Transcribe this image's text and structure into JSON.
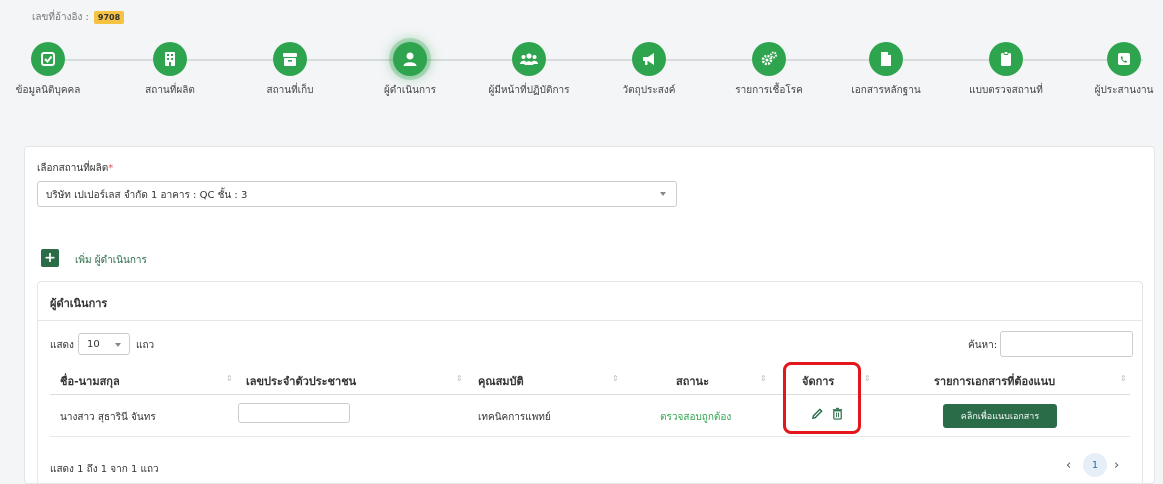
{
  "reference": {
    "label": "เลขที่อ้างอิง :",
    "number": "9708"
  },
  "steps": [
    {
      "label": "ข้อมูลนิติบุคคล",
      "icon": "check-square-icon",
      "active": false
    },
    {
      "label": "สถานที่ผลิต",
      "icon": "building-icon",
      "active": false
    },
    {
      "label": "สถานที่เก็บ",
      "icon": "archive-box-icon",
      "active": false
    },
    {
      "label": "ผู้ดำเนินการ",
      "icon": "user-icon",
      "active": true
    },
    {
      "label": "ผู้มีหน้าที่ปฏิบัติการ",
      "icon": "users-icon",
      "active": false
    },
    {
      "label": "วัตถุประสงค์",
      "icon": "megaphone-icon",
      "active": false
    },
    {
      "label": "รายการเชื้อโรค",
      "icon": "cogs-icon",
      "active": false
    },
    {
      "label": "เอกสารหลักฐาน",
      "icon": "file-icon",
      "active": false
    },
    {
      "label": "แบบตรวจสถานที่",
      "icon": "clipboard-icon",
      "active": false
    },
    {
      "label": "ผู้ประสานงาน",
      "icon": "phone-icon",
      "active": false
    }
  ],
  "form": {
    "select_label": "เลือกสถานที่ผลิต",
    "required_mark": "*",
    "select_value": "บริษัท เปเปอร์เลส จำกัด 1 อาคาร : QC ชั้น : 3"
  },
  "add_button": {
    "label": "เพิ่ม ผู้ดำเนินการ",
    "symbol": "+"
  },
  "panel": {
    "title": "ผู้ดำเนินการ",
    "length_label": "แสดง",
    "length_value": "10",
    "length_unit": "แถว",
    "search_label": "ค้นหา:",
    "columns": [
      "ชื่อ-นามสกุล",
      "เลขประจำตัวประชาชน",
      "คุณสมบัติ",
      "สถานะ",
      "จัดการ",
      "รายการเอกสารที่ต้องแนบ"
    ],
    "sort_glyph": "⇕",
    "rows": [
      {
        "name": "นางสาว สุธารินี จันทร",
        "id_card": "",
        "qualification": "เทคนิคการแพทย์",
        "status": "ตรวจสอบถูกต้อง",
        "doc_button": "คลิกเพื่อแนบเอกสาร"
      }
    ],
    "info": "แสดง 1 ถึง 1 จาก 1 แถว",
    "pagination": {
      "prev": "‹",
      "current": "1",
      "next": "›"
    }
  },
  "colors": {
    "primary": "#2fa44f",
    "dark": "#2a6b48",
    "highlight": "#e3161b"
  }
}
